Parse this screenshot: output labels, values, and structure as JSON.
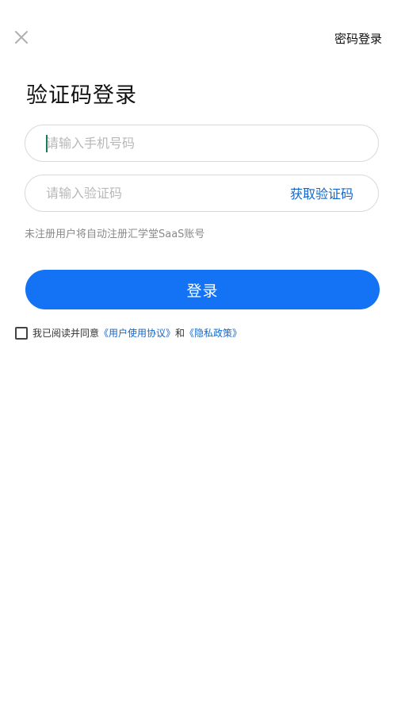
{
  "header": {
    "close_icon": "close-icon",
    "password_login_label": "密码登录"
  },
  "title": "验证码登录",
  "form": {
    "phone_value": "",
    "phone_placeholder": "请输入手机号码",
    "code_value": "",
    "code_placeholder": "请输入验证码",
    "get_code_label": "获取验证码",
    "hint": "未注册用户将自动注册汇学堂SaaS账号",
    "login_label": "登录"
  },
  "agreement": {
    "checked": false,
    "prefix": "我已阅读并同意",
    "user_agreement": "《用户使用协议》",
    "conjunction": "和",
    "privacy_policy": "《隐私政策》"
  },
  "colors": {
    "primary": "#1472f4",
    "link": "#1467c8",
    "hint": "#8a8a8a",
    "border": "#d9d9d9"
  }
}
